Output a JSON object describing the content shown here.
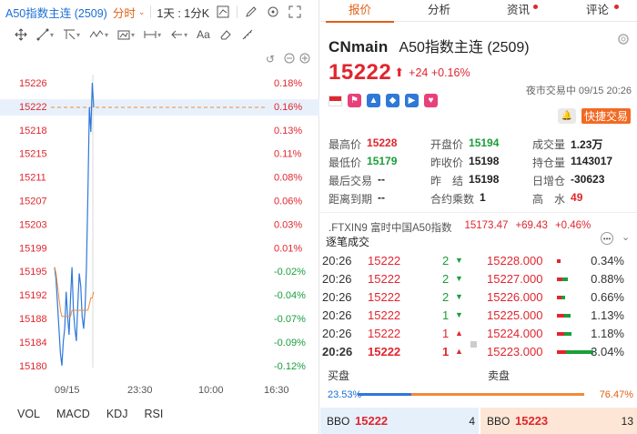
{
  "topbar": {
    "symbol": "A50指数主连 (2509)",
    "timeframe": "分时",
    "intervals": "1天 : 1分K"
  },
  "chart": {
    "y_labels": [
      "15226",
      "15222",
      "15218",
      "15215",
      "15211",
      "15207",
      "15203",
      "15199",
      "15195",
      "15192",
      "15188",
      "15184",
      "15180"
    ],
    "pct_labels": [
      "0.18%",
      "0.16%",
      "0.13%",
      "0.11%",
      "0.08%",
      "0.06%",
      "0.03%",
      "0.01%",
      "-0.02%",
      "-0.04%",
      "-0.07%",
      "-0.09%",
      "-0.12%"
    ],
    "x_labels": [
      "09/15",
      "23:30",
      "10:00",
      "16:30"
    ],
    "current_price": "15222",
    "current_pct": "0.16%"
  },
  "chart_data": {
    "type": "line",
    "title": "",
    "xlabel": "",
    "ylabel": "",
    "x_ticks": [
      "09/15",
      "23:30",
      "10:00",
      "16:30"
    ],
    "ylim": [
      15178,
      15228
    ],
    "series": [
      {
        "values": [
          15196,
          15194,
          15190,
          15186,
          15182,
          15180,
          15184,
          15186,
          15192,
          15188,
          15185,
          15191,
          15196,
          15189,
          15186,
          15184,
          15190,
          15195,
          15193,
          15188,
          15186,
          15189,
          15196,
          15208,
          15222,
          15218,
          15226,
          15222
        ]
      },
      {
        "values": [
          15196,
          15195,
          15193,
          15191,
          15189,
          15188,
          15188,
          15188,
          15188,
          15188,
          15188,
          15188,
          15189,
          15189,
          15189,
          15189,
          15189,
          15189,
          15189,
          15189,
          15189,
          15189,
          15189,
          15189,
          15190,
          15191,
          15191,
          15192
        ]
      }
    ]
  },
  "bottom_tabs": [
    "VOL",
    "MACD",
    "KDJ",
    "RSI"
  ],
  "right": {
    "tabs": [
      "报价",
      "分析",
      "资讯",
      "评论"
    ],
    "code": "CNmain",
    "name": "A50指数主连 (2509)",
    "price": "15222",
    "arrow": "⬆",
    "change": "+24  +0.16%",
    "session": "夜市交易中 09/15 20:26",
    "quick_trade": "快捷交易",
    "stats": [
      {
        "label": "最高价",
        "value": "15228",
        "color": "red"
      },
      {
        "label": "开盘价",
        "value": "15194",
        "color": "green"
      },
      {
        "label": "成交量",
        "value": "1.23万",
        "color": ""
      },
      {
        "label": "最低价",
        "value": "15179",
        "color": "green"
      },
      {
        "label": "昨收价",
        "value": "15198",
        "color": ""
      },
      {
        "label": "持仓量",
        "value": "1143017",
        "color": ""
      },
      {
        "label": "最后交易",
        "value": "--",
        "color": ""
      },
      {
        "label": "昨　结",
        "value": "15198",
        "color": ""
      },
      {
        "label": "日增仓",
        "value": "-30623",
        "color": ""
      },
      {
        "label": "距离到期",
        "value": "--",
        "color": ""
      },
      {
        "label": "合约乘数",
        "value": "1",
        "color": ""
      },
      {
        "label": "高　水",
        "value": "49",
        "color": "red"
      }
    ],
    "index_line": {
      "name": ".FTXIN9  富时中国A50指数",
      "value": "15173.47",
      "change": "+69.43",
      "pct": "+0.46%"
    },
    "ticks_title": "逐笔成交",
    "trades": [
      {
        "time": "20:26",
        "price": "15222",
        "vol": "2",
        "dir": "down"
      },
      {
        "time": "20:26",
        "price": "15222",
        "vol": "2",
        "dir": "down"
      },
      {
        "time": "20:26",
        "price": "15222",
        "vol": "2",
        "dir": "down"
      },
      {
        "time": "20:26",
        "price": "15222",
        "vol": "1",
        "dir": "down"
      },
      {
        "time": "20:26",
        "price": "15222",
        "vol": "1",
        "dir": "up"
      },
      {
        "time": "20:26",
        "price": "15222",
        "vol": "1",
        "dir": "up"
      }
    ],
    "levels": [
      {
        "price": "15228.000",
        "pct": "0.34%",
        "value": 0.34
      },
      {
        "price": "15227.000",
        "pct": "0.88%",
        "value": 0.88
      },
      {
        "price": "15226.000",
        "pct": "0.66%",
        "value": 0.66
      },
      {
        "price": "15225.000",
        "pct": "1.13%",
        "value": 1.13
      },
      {
        "price": "15224.000",
        "pct": "1.18%",
        "value": 1.18
      },
      {
        "price": "15223.000",
        "pct": "3.04%",
        "value": 3.04
      }
    ],
    "buy_label": "买盘",
    "sell_label": "卖盘",
    "buy_pct": "23.53%",
    "sell_pct": "76.47%",
    "bbo_label": "BBO",
    "bid": {
      "price": "15222",
      "size": "4"
    },
    "ask": {
      "price": "15223",
      "size": "13"
    }
  }
}
